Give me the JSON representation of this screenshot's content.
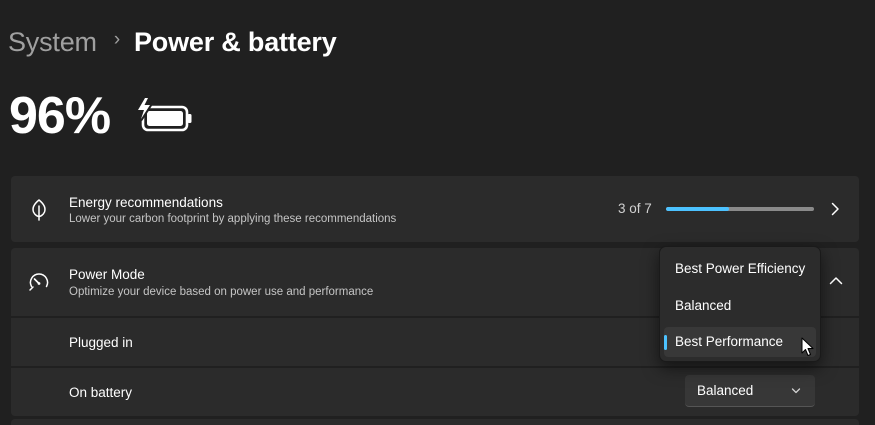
{
  "breadcrumb": {
    "parent": "System",
    "separator": "›",
    "current": "Power & battery"
  },
  "battery": {
    "percent_label": "96%",
    "icon": "battery-charging-icon",
    "level": 0.96
  },
  "energy_recommendations": {
    "icon": "leaf-icon",
    "title": "Energy recommendations",
    "subtitle": "Lower your carbon footprint by applying these recommendations",
    "count_label": "3 of 7",
    "progress": 0.4286,
    "chevron_icon": "chevron-right-icon"
  },
  "power_mode": {
    "icon": "speedometer-icon",
    "title": "Power Mode",
    "subtitle": "Optimize your device based on power use and performance",
    "chevron_icon": "chevron-up-icon",
    "plugged_in": {
      "label": "Plugged in"
    },
    "on_battery": {
      "label": "On battery",
      "value": "Balanced",
      "chevron_icon": "chevron-down-icon"
    },
    "dropdown": {
      "options": [
        "Best Power Efficiency",
        "Balanced",
        "Best Performance"
      ],
      "selected_index": 2
    }
  },
  "colors": {
    "accent": "#4cc2ff",
    "background": "#202020",
    "card": "#2b2b2b"
  }
}
